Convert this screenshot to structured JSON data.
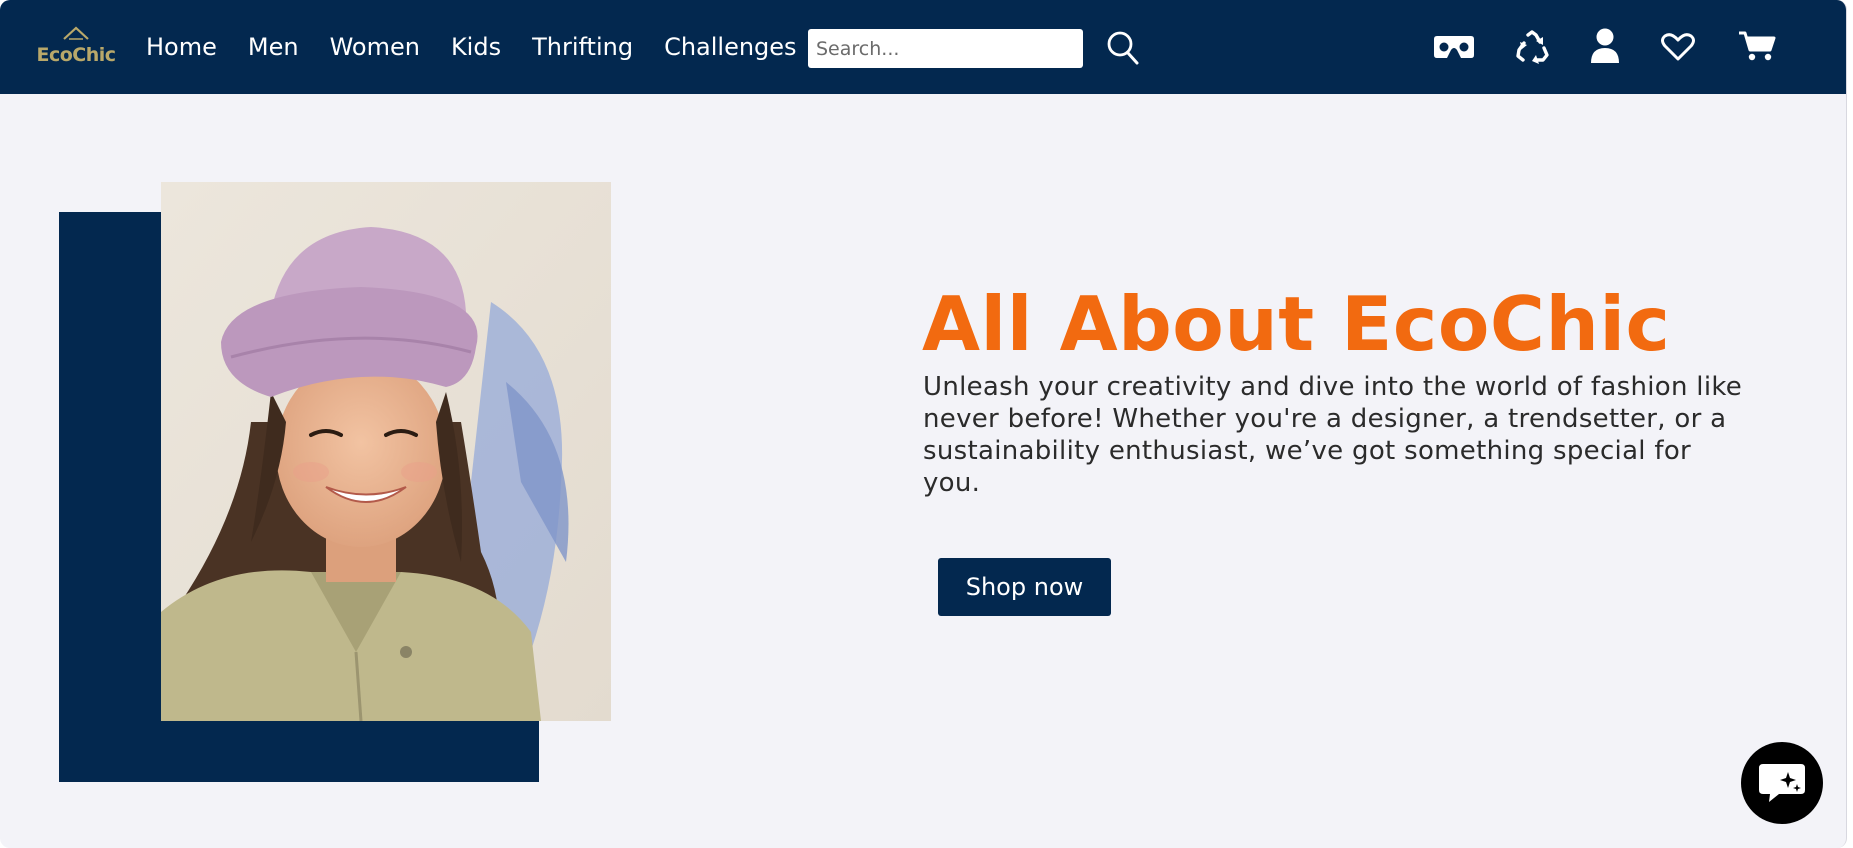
{
  "brand": {
    "logo_text": "EcoChic"
  },
  "nav": {
    "links": [
      "Home",
      "Men",
      "Women",
      "Kids",
      "Thrifting",
      "Challenges"
    ]
  },
  "search": {
    "placeholder": "Search..."
  },
  "icons": {
    "search": "search-icon",
    "vr": "vr-headset-icon",
    "recycle": "recycle-icon",
    "user": "user-icon",
    "wishlist": "heart-icon",
    "cart": "cart-icon",
    "chat": "chat-icon"
  },
  "hero": {
    "title": "All About EcoChic",
    "text": "Unleash your creativity and dive into the world of fashion like never before! Whether you're a designer, a trendsetter, or a sustainability enthusiast, we’ve got something special for you.",
    "cta_label": "Shop now"
  },
  "colors": {
    "navy": "#03284f",
    "accent_orange": "#f26a10",
    "page_bg": "#f3f3f8"
  }
}
